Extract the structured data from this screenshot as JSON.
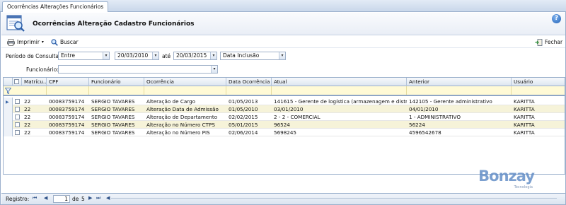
{
  "window": {
    "tab_title": "Ocorrências Alterações Funcionários"
  },
  "header": {
    "title": "Ocorrências Alteração Cadastro Funcionários",
    "help_symbol": "?"
  },
  "toolbar": {
    "print_label": "Imprimir",
    "search_label": "Buscar",
    "close_label": "Fechar"
  },
  "filters": {
    "periodo_label": "Período de Consulta:",
    "periodo_value": "Entre",
    "date_from": "20/03/2010",
    "ate_label": "até",
    "date_to": "20/03/2015",
    "date_type": "Data Inclusão",
    "funcionario_label": "Funcionário:",
    "funcionario_value": ""
  },
  "grid": {
    "columns": [
      "Matrícu...",
      "CPF",
      "Funcionário",
      "Ocorrência",
      "Data Ocorrência",
      "Atual",
      "Anterior",
      "Usuário"
    ],
    "rows": [
      [
        "22",
        "00083759174",
        "SERGIO TAVARES",
        "Alteração de Cargo",
        "01/05/2013",
        "141615 - Gerente de logística (armazenagem e distri...",
        "142105 - Gerente administrativo",
        "KARITTA"
      ],
      [
        "22",
        "00083759174",
        "SERGIO TAVARES",
        "Alteração Data de Admissão",
        "01/05/2010",
        "03/01/2010",
        "04/01/2010",
        "KARITTA"
      ],
      [
        "22",
        "00083759174",
        "SERGIO TAVARES",
        "Alteração de Departamento",
        "02/02/2015",
        "2 - 2 - COMERCIAL",
        "1 - ADMINISTRATIVO",
        "KARITTA"
      ],
      [
        "22",
        "00083759174",
        "SERGIO TAVARES",
        "Alteração no Número CTPS",
        "05/01/2015",
        "96524",
        "56224",
        "KARITTA"
      ],
      [
        "22",
        "00083759174",
        "SERGIO TAVARES",
        "Alteração no Número PIS",
        "02/06/2014",
        "5698245",
        "4596542678",
        "KARITTA"
      ]
    ]
  },
  "status": {
    "records_label": "Registro:",
    "current": "1",
    "of_label": "de",
    "total": "5"
  },
  "brand": {
    "logo_text": "Bonzay",
    "logo_sub": "Tecnologia"
  },
  "colors": {
    "accent": "#5b88c4",
    "filter_row": "#fffad6",
    "alt_row": "#f6f3d9"
  }
}
